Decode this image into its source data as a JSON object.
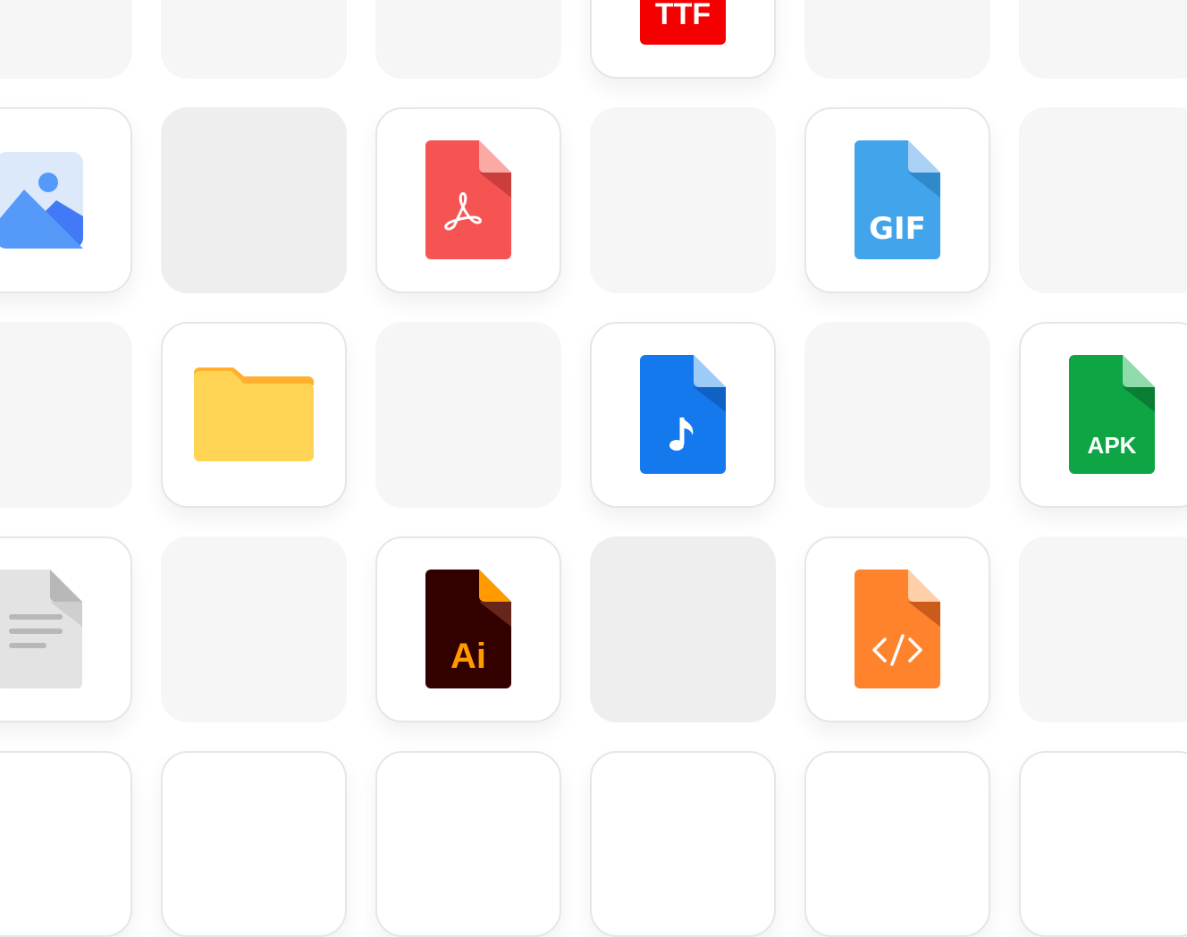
{
  "tiles": [
    {
      "kind": "empty"
    },
    {
      "kind": "empty"
    },
    {
      "kind": "empty"
    },
    {
      "kind": "card",
      "icon": "ttf-file-icon",
      "label": "TTF",
      "color": "#f50000"
    },
    {
      "kind": "empty"
    },
    {
      "kind": "empty"
    },
    {
      "kind": "card",
      "icon": "image-file-icon"
    },
    {
      "kind": "empty-dark"
    },
    {
      "kind": "card",
      "icon": "pdf-file-icon",
      "color": "#f65353"
    },
    {
      "kind": "empty"
    },
    {
      "kind": "card",
      "icon": "gif-file-icon",
      "label": "GIF",
      "color": "#42a5ec"
    },
    {
      "kind": "empty"
    },
    {
      "kind": "empty"
    },
    {
      "kind": "card",
      "icon": "folder-icon",
      "color": "#ffd454"
    },
    {
      "kind": "empty"
    },
    {
      "kind": "card",
      "icon": "audio-file-icon",
      "color": "#1479ec"
    },
    {
      "kind": "empty"
    },
    {
      "kind": "card",
      "icon": "apk-file-icon",
      "label": "APK",
      "color": "#0ea645"
    },
    {
      "kind": "card",
      "icon": "text-document-icon",
      "color": "#e3e3e3"
    },
    {
      "kind": "empty"
    },
    {
      "kind": "card",
      "icon": "illustrator-file-icon",
      "label": "Ai",
      "color": "#330000"
    },
    {
      "kind": "empty-dark"
    },
    {
      "kind": "card",
      "icon": "code-file-icon",
      "color": "#ff822d"
    },
    {
      "kind": "empty"
    },
    {
      "kind": "card"
    },
    {
      "kind": "card"
    },
    {
      "kind": "card"
    },
    {
      "kind": "card"
    },
    {
      "kind": "card"
    },
    {
      "kind": "card"
    }
  ]
}
